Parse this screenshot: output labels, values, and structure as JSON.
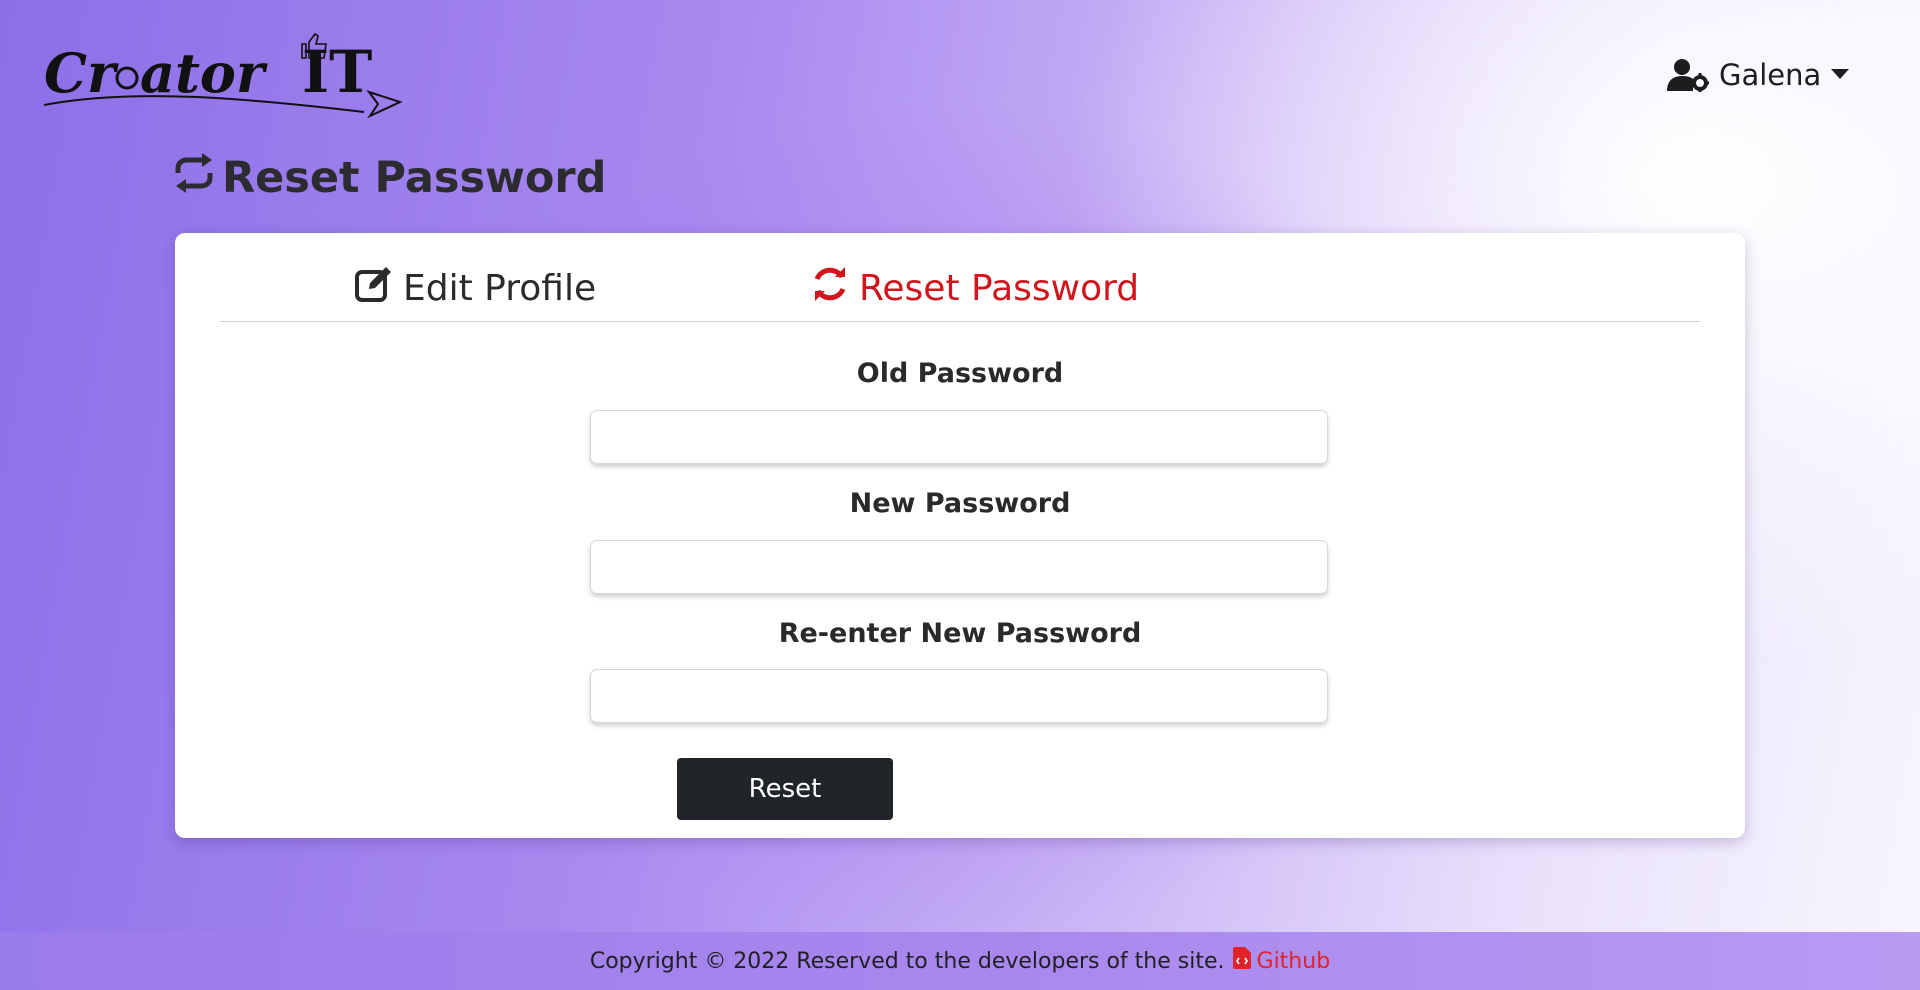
{
  "header": {
    "logo_alt": "Creator IT",
    "user": {
      "name": "Galena",
      "icon": "user-cog-icon",
      "dropdown_icon": "caret-down-icon"
    }
  },
  "page": {
    "title": "Reset Password",
    "title_icon": "sync-icon"
  },
  "tabs": [
    {
      "label": "Edit Profile",
      "icon": "edit-icon",
      "active": false
    },
    {
      "label": "Reset Password",
      "icon": "sync-icon",
      "active": true
    }
  ],
  "form": {
    "old_password": {
      "label": "Old Password",
      "value": ""
    },
    "new_password": {
      "label": "New Password",
      "value": ""
    },
    "confirm_password": {
      "label": "Re-enter New Password",
      "value": ""
    },
    "submit_label": "Reset"
  },
  "footer": {
    "copyright": "Copyright © 2022 Reserved to the developers of the site.",
    "link_label": "Github",
    "link_icon": "file-code-icon"
  },
  "colors": {
    "active_tab": "#d0161c",
    "button_bg": "#212529",
    "footer_link": "#e0232b"
  }
}
